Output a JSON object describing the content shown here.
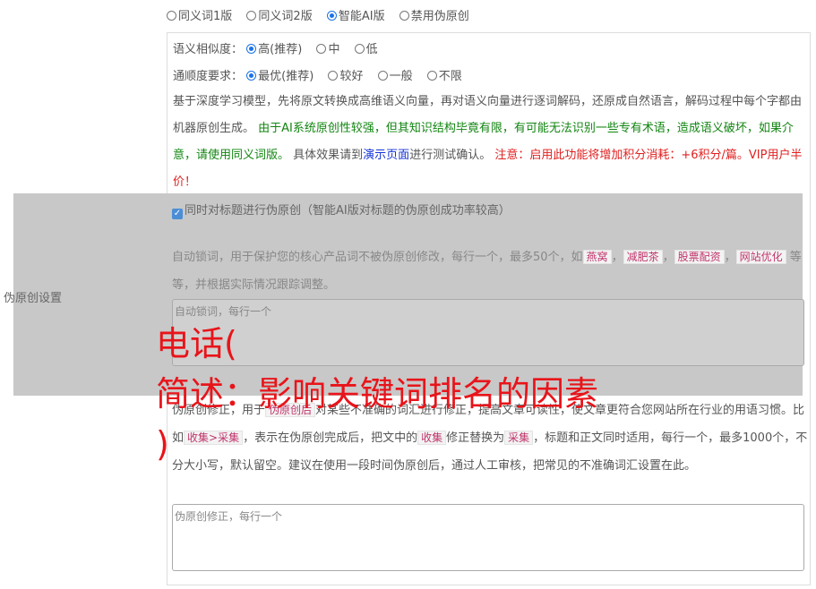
{
  "mode_options": [
    "同义词1版",
    "同义词2版",
    "智能AI版",
    "禁用伪原创"
  ],
  "mode_selected": 2,
  "similarity": {
    "label": "语义相似度：",
    "options": [
      "高(推荐)",
      "中",
      "低"
    ],
    "selected": 0
  },
  "fluency": {
    "label": "通顺度要求：",
    "options": [
      "最优(推荐)",
      "较好",
      "一般",
      "不限"
    ],
    "selected": 0
  },
  "description": {
    "part1": "基于深度学习模型，先将原文转换成高维语义向量，再对语义向量进行逐词解码，还原成自然语言，解码过程中每个字都由机器原创生成。",
    "green": "由于AI系统原创性较强，但其知识结构毕竟有限，有可能无法识别一些专有术语，造成语义破坏，如果介意，请使用同义词版。",
    "part2": "具体效果请到",
    "link": "演示页面",
    "part3": "进行测试确认。",
    "red": "注意：启用此功能将增加积分消耗：+6积分/篇。VIP用户半价！"
  },
  "left_label": "伪原创设置",
  "title_option": "同时对标题进行伪原创（智能AI版对标题的伪原创成功率较高）",
  "lock": {
    "intro": "自动锁词，用于保护您的核心产品词不被伪原创修改，每行一个，最多50个，如",
    "tags": [
      "燕窝",
      "减肥茶",
      "股票配资",
      "网站优化"
    ],
    "sep": "，",
    "outro": "等等，并根据实际情况跟踪调整。",
    "placeholder": "自动锁词，每行一个"
  },
  "fix": {
    "intro": "伪原创修正，用于",
    "tag1": "伪原创后",
    "mid1": "对某些不准确的词汇进行修正，提高文章可读性，使文章更符合您网站所在行业的用语习惯。比如",
    "tag2": "收集>采集",
    "mid2": "，表示在伪原创完成后，把文中的",
    "tag3": "收集",
    "mid3": "修正替换为",
    "tag4": "采集",
    "outro": "，标题和正文同时适用，每行一个，最多1000个，不分大小写，默认留空。建议在使用一段时间伪原创后，通过人工审核，把常见的不准确词汇设置在此。",
    "placeholder": "伪原创修正，每行一个"
  },
  "overlay_lines": [
    "电话(",
    "简述：影响关键词排名的因素",
    ")"
  ]
}
